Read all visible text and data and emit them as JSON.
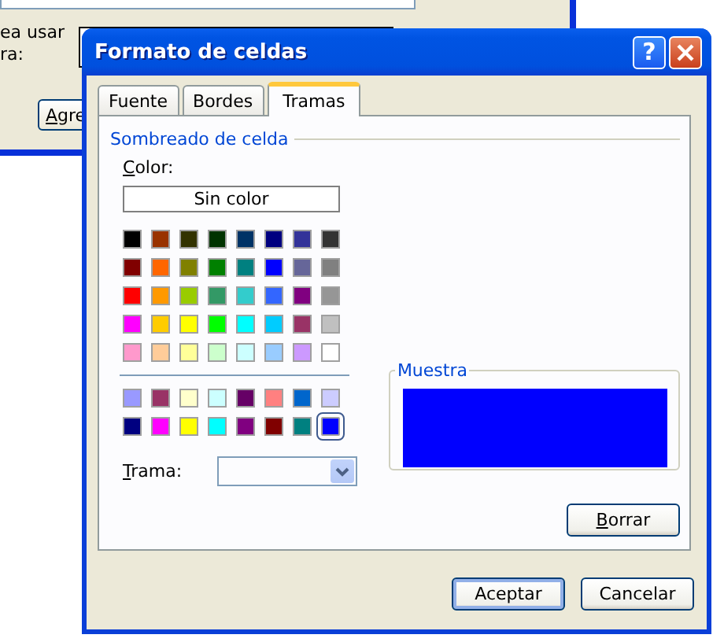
{
  "background_window": {
    "label_lines": [
      "ea usar",
      "ra:"
    ],
    "button": "Agre"
  },
  "dialog": {
    "title": "Formato de celdas",
    "help_button": "?"
  },
  "tabs": [
    {
      "label": "Fuente",
      "selected": false
    },
    {
      "label": "Bordes",
      "selected": false
    },
    {
      "label": "Tramas",
      "selected": true
    }
  ],
  "shading": {
    "group_title": "Sombreado de celda",
    "color_label": "Color:",
    "no_color_button": "Sin color",
    "swatches": [
      {
        "color": "#000000",
        "selected": false
      },
      {
        "color": "#993300",
        "selected": false
      },
      {
        "color": "#333300",
        "selected": false
      },
      {
        "color": "#003300",
        "selected": false
      },
      {
        "color": "#003366",
        "selected": false
      },
      {
        "color": "#000080",
        "selected": false
      },
      {
        "color": "#333399",
        "selected": false
      },
      {
        "color": "#333333",
        "selected": false
      },
      {
        "color": "#800000",
        "selected": false
      },
      {
        "color": "#ff6600",
        "selected": false
      },
      {
        "color": "#808000",
        "selected": false
      },
      {
        "color": "#008000",
        "selected": false
      },
      {
        "color": "#008080",
        "selected": false
      },
      {
        "color": "#0000ff",
        "selected": false
      },
      {
        "color": "#666699",
        "selected": false
      },
      {
        "color": "#808080",
        "selected": false
      },
      {
        "color": "#ff0000",
        "selected": false
      },
      {
        "color": "#ff9900",
        "selected": false
      },
      {
        "color": "#99cc00",
        "selected": false
      },
      {
        "color": "#339966",
        "selected": false
      },
      {
        "color": "#33cccc",
        "selected": false
      },
      {
        "color": "#3366ff",
        "selected": false
      },
      {
        "color": "#800080",
        "selected": false
      },
      {
        "color": "#969696",
        "selected": false
      },
      {
        "color": "#ff00ff",
        "selected": false
      },
      {
        "color": "#ffcc00",
        "selected": false
      },
      {
        "color": "#ffff00",
        "selected": false
      },
      {
        "color": "#00ff00",
        "selected": false
      },
      {
        "color": "#00ffff",
        "selected": false
      },
      {
        "color": "#00ccff",
        "selected": false
      },
      {
        "color": "#993366",
        "selected": false
      },
      {
        "color": "#c0c0c0",
        "selected": false
      },
      {
        "color": "#ff99cc",
        "selected": false
      },
      {
        "color": "#ffcc99",
        "selected": false
      },
      {
        "color": "#ffff99",
        "selected": false
      },
      {
        "color": "#ccffcc",
        "selected": false
      },
      {
        "color": "#ccffff",
        "selected": false
      },
      {
        "color": "#99ccff",
        "selected": false
      },
      {
        "color": "#cc99ff",
        "selected": false
      },
      {
        "color": "#ffffff",
        "selected": false
      }
    ],
    "chart_swatches": [
      {
        "color": "#9999ff",
        "selected": false
      },
      {
        "color": "#993366",
        "selected": false
      },
      {
        "color": "#ffffcc",
        "selected": false
      },
      {
        "color": "#ccffff",
        "selected": false
      },
      {
        "color": "#660066",
        "selected": false
      },
      {
        "color": "#ff8080",
        "selected": false
      },
      {
        "color": "#0066cc",
        "selected": false
      },
      {
        "color": "#ccccff",
        "selected": false
      },
      {
        "color": "#000080",
        "selected": false
      },
      {
        "color": "#ff00ff",
        "selected": false
      },
      {
        "color": "#ffff00",
        "selected": false
      },
      {
        "color": "#00ffff",
        "selected": false
      },
      {
        "color": "#800080",
        "selected": false
      },
      {
        "color": "#800000",
        "selected": false
      },
      {
        "color": "#008080",
        "selected": false
      },
      {
        "color": "#0000ff",
        "selected": true
      }
    ],
    "pattern_label": "Trama:"
  },
  "sample": {
    "group_title": "Muestra"
  },
  "buttons": {
    "clear": "Borrar",
    "ok": "Aceptar",
    "cancel": "Cancelar"
  }
}
